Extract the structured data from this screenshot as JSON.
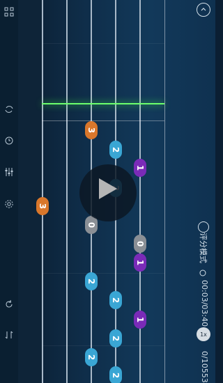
{
  "notes": [
    {
      "text": "3",
      "color": "orange"
    },
    {
      "text": "2",
      "color": "blue"
    },
    {
      "text": "1",
      "color": "purple"
    },
    {
      "text": "2",
      "color": "blue"
    },
    {
      "text": "3",
      "color": "orange"
    },
    {
      "text": "0",
      "color": "gray"
    },
    {
      "text": "0",
      "color": "gray"
    },
    {
      "text": "1",
      "color": "purple"
    },
    {
      "text": "2",
      "color": "blue"
    },
    {
      "text": "2",
      "color": "blue"
    },
    {
      "text": "1",
      "color": "purple"
    },
    {
      "text": "2",
      "color": "blue"
    },
    {
      "text": "2",
      "color": "blue"
    },
    {
      "text": "2",
      "color": "blue"
    }
  ],
  "right_panel": {
    "score_mode_label": "评分模式",
    "time": "00:03/03:40",
    "speed": "1x",
    "progress": "0/10553"
  },
  "left_bar": {
    "icons": [
      "grid-icon",
      "loop-icon",
      "timer-icon",
      "mixer-icon",
      "settings-icon",
      "refresh-icon",
      "swap-icon"
    ]
  }
}
